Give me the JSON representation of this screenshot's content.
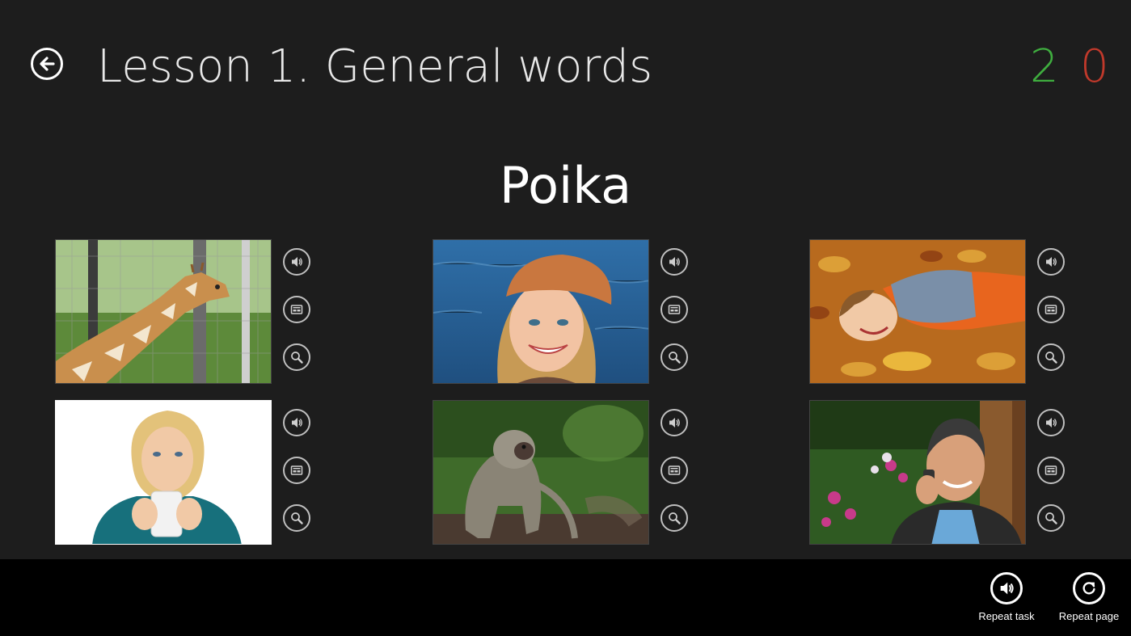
{
  "header": {
    "back_icon": "arrow-left-icon",
    "title": "Lesson 1. General words",
    "score_correct": "2",
    "score_wrong": "0",
    "colors": {
      "correct": "#3fae3f",
      "wrong": "#c0392b"
    }
  },
  "word": "Poika",
  "cards": [
    {
      "subject": "giraffe",
      "icons": [
        "speaker-icon",
        "caption-icon",
        "magnifier-icon"
      ]
    },
    {
      "subject": "girl-in-cap",
      "icons": [
        "speaker-icon",
        "caption-icon",
        "magnifier-icon"
      ]
    },
    {
      "subject": "boy-in-leaves",
      "icons": [
        "speaker-icon",
        "caption-icon",
        "magnifier-icon"
      ]
    },
    {
      "subject": "woman-with-mug",
      "icons": [
        "speaker-icon",
        "caption-icon",
        "magnifier-icon"
      ]
    },
    {
      "subject": "monkey",
      "icons": [
        "speaker-icon",
        "caption-icon",
        "magnifier-icon"
      ]
    },
    {
      "subject": "man-on-phone",
      "icons": [
        "speaker-icon",
        "caption-icon",
        "magnifier-icon"
      ]
    }
  ],
  "appbar": {
    "repeat_task": "Repeat task",
    "repeat_page": "Repeat page"
  }
}
